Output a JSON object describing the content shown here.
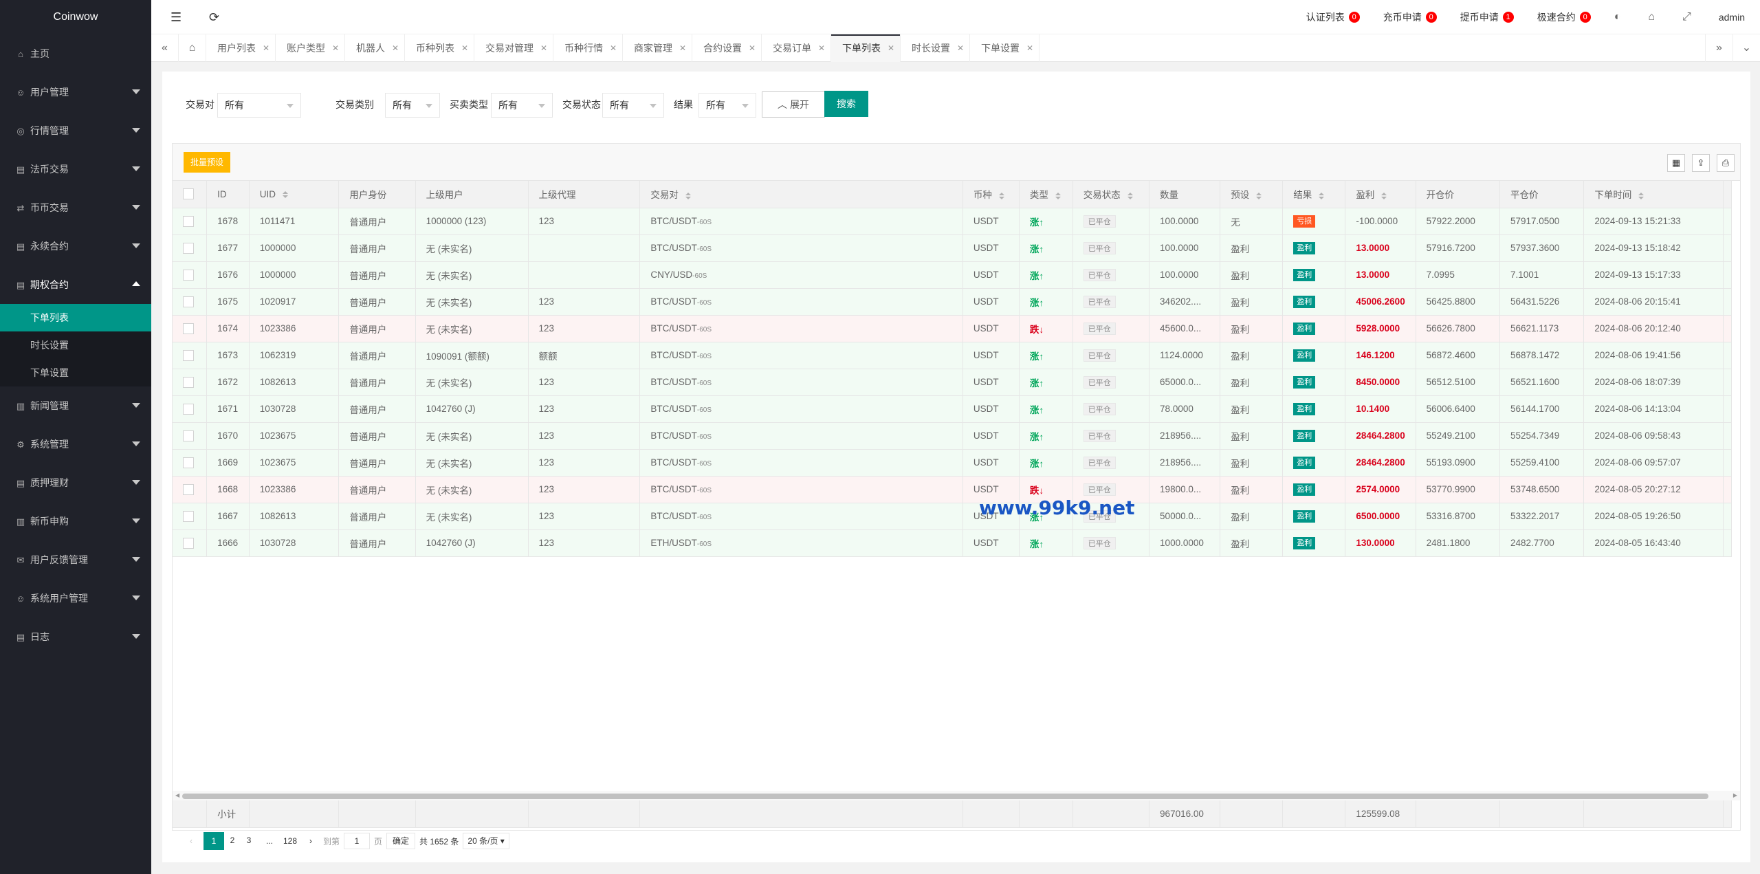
{
  "brand": "Coinwow",
  "sidebar": {
    "items": [
      {
        "label": "主页",
        "icon": "home-icon",
        "expand": false
      },
      {
        "label": "用户管理",
        "icon": "user-icon",
        "expand": true
      },
      {
        "label": "行情管理",
        "icon": "coin-icon",
        "expand": true
      },
      {
        "label": "法币交易",
        "icon": "doc-icon",
        "expand": true
      },
      {
        "label": "币币交易",
        "icon": "exchange-icon",
        "expand": true
      },
      {
        "label": "永续合约",
        "icon": "doc-icon",
        "expand": true
      },
      {
        "label": "期权合约",
        "icon": "doc-icon",
        "expand": true,
        "open": true
      }
    ],
    "submenu": [
      "下单列表",
      "时长设置",
      "下单设置"
    ],
    "items2": [
      {
        "label": "新闻管理",
        "icon": "news-icon"
      },
      {
        "label": "系统管理",
        "icon": "gear-icon"
      },
      {
        "label": "质押理财",
        "icon": "doc-icon"
      },
      {
        "label": "新币申购",
        "icon": "news-icon"
      },
      {
        "label": "用户反馈管理",
        "icon": "feedback-icon"
      },
      {
        "label": "系统用户管理",
        "icon": "user-icon"
      },
      {
        "label": "日志",
        "icon": "doc-icon"
      }
    ]
  },
  "header": {
    "links": [
      {
        "label": "认证列表",
        "count": "0"
      },
      {
        "label": "充币申请",
        "count": "0"
      },
      {
        "label": "提币申请",
        "count": "1"
      },
      {
        "label": "极速合约",
        "count": "0"
      }
    ],
    "user": "admin"
  },
  "tabs": [
    "用户列表",
    "账户类型",
    "机器人",
    "币种列表",
    "交易对管理",
    "币种行情",
    "商家管理",
    "合约设置",
    "交易订单",
    "下单列表",
    "时长设置",
    "下单设置"
  ],
  "active_tab": 9,
  "filters": {
    "pair_label": "交易对",
    "pair_value": "所有",
    "category_label": "交易类别",
    "category_value": "所有",
    "side_label": "买卖类型",
    "side_value": "所有",
    "status_label": "交易状态",
    "status_value": "所有",
    "result_label": "结果",
    "result_value": "所有",
    "expand_label": "展开",
    "search_label": "搜索"
  },
  "toolbar": {
    "batch_label": "批量预设"
  },
  "columns": [
    "ID",
    "UID",
    "用户身份",
    "上级用户",
    "上级代理",
    "交易对",
    "币种",
    "类型",
    "交易状态",
    "数量",
    "预设",
    "结果",
    "盈利",
    "开仓价",
    "平仓价",
    "下单时间"
  ],
  "rows": [
    {
      "id": "1678",
      "uid": "1011471",
      "role": "普通用户",
      "parent": "1000000 (123)",
      "agent": "123",
      "pair": "BTC/USDT",
      "pair_suffix": "-60S",
      "coin": "USDT",
      "type": "涨↑",
      "dir": "up",
      "status": "已平仓",
      "qty": "100.0000",
      "preset": "无",
      "result": "亏损",
      "res_type": "lose",
      "profit": "-100.0000",
      "open": "57922.2000",
      "close": "57917.0500",
      "time": "2024-09-13 15:21:33"
    },
    {
      "id": "1677",
      "uid": "1000000",
      "role": "普通用户",
      "parent": "无 (未实名)",
      "agent": "",
      "pair": "BTC/USDT",
      "pair_suffix": "-60S",
      "coin": "USDT",
      "type": "涨↑",
      "dir": "up",
      "status": "已平仓",
      "qty": "100.0000",
      "preset": "盈利",
      "result": "盈利",
      "res_type": "win",
      "profit": "13.0000",
      "open": "57916.7200",
      "close": "57937.3600",
      "time": "2024-09-13 15:18:42"
    },
    {
      "id": "1676",
      "uid": "1000000",
      "role": "普通用户",
      "parent": "无 (未实名)",
      "agent": "",
      "pair": "CNY/USD",
      "pair_suffix": "-60S",
      "coin": "USDT",
      "type": "涨↑",
      "dir": "up",
      "status": "已平仓",
      "qty": "100.0000",
      "preset": "盈利",
      "result": "盈利",
      "res_type": "win",
      "profit": "13.0000",
      "open": "7.0995",
      "close": "7.1001",
      "time": "2024-09-13 15:17:33"
    },
    {
      "id": "1675",
      "uid": "1020917",
      "role": "普通用户",
      "parent": "无 (未实名)",
      "agent": "123",
      "pair": "BTC/USDT",
      "pair_suffix": "-60S",
      "coin": "USDT",
      "type": "涨↑",
      "dir": "up",
      "status": "已平仓",
      "qty": "346202....",
      "preset": "盈利",
      "result": "盈利",
      "res_type": "win",
      "profit": "45006.2600",
      "open": "56425.8800",
      "close": "56431.5226",
      "time": "2024-08-06 20:15:41"
    },
    {
      "id": "1674",
      "uid": "1023386",
      "role": "普通用户",
      "parent": "无 (未实名)",
      "agent": "123",
      "pair": "BTC/USDT",
      "pair_suffix": "-60S",
      "coin": "USDT",
      "type": "跌↓",
      "dir": "down",
      "status": "已平仓",
      "qty": "45600.0...",
      "preset": "盈利",
      "result": "盈利",
      "res_type": "win",
      "profit": "5928.0000",
      "open": "56626.7800",
      "close": "56621.1173",
      "time": "2024-08-06 20:12:40"
    },
    {
      "id": "1673",
      "uid": "1062319",
      "role": "普通用户",
      "parent": "1090091 (额额)",
      "agent": "额额",
      "pair": "BTC/USDT",
      "pair_suffix": "-60S",
      "coin": "USDT",
      "type": "涨↑",
      "dir": "up",
      "status": "已平仓",
      "qty": "1124.0000",
      "preset": "盈利",
      "result": "盈利",
      "res_type": "win",
      "profit": "146.1200",
      "open": "56872.4600",
      "close": "56878.1472",
      "time": "2024-08-06 19:41:56"
    },
    {
      "id": "1672",
      "uid": "1082613",
      "role": "普通用户",
      "parent": "无 (未实名)",
      "agent": "123",
      "pair": "BTC/USDT",
      "pair_suffix": "-60S",
      "coin": "USDT",
      "type": "涨↑",
      "dir": "up",
      "status": "已平仓",
      "qty": "65000.0...",
      "preset": "盈利",
      "result": "盈利",
      "res_type": "win",
      "profit": "8450.0000",
      "open": "56512.5100",
      "close": "56521.1600",
      "time": "2024-08-06 18:07:39"
    },
    {
      "id": "1671",
      "uid": "1030728",
      "role": "普通用户",
      "parent": "1042760 (J)",
      "agent": "123",
      "pair": "BTC/USDT",
      "pair_suffix": "-60S",
      "coin": "USDT",
      "type": "涨↑",
      "dir": "up",
      "status": "已平仓",
      "qty": "78.0000",
      "preset": "盈利",
      "result": "盈利",
      "res_type": "win",
      "profit": "10.1400",
      "open": "56006.6400",
      "close": "56144.1700",
      "time": "2024-08-06 14:13:04"
    },
    {
      "id": "1670",
      "uid": "1023675",
      "role": "普通用户",
      "parent": "无 (未实名)",
      "agent": "123",
      "pair": "BTC/USDT",
      "pair_suffix": "-60S",
      "coin": "USDT",
      "type": "涨↑",
      "dir": "up",
      "status": "已平仓",
      "qty": "218956....",
      "preset": "盈利",
      "result": "盈利",
      "res_type": "win",
      "profit": "28464.2800",
      "open": "55249.2100",
      "close": "55254.7349",
      "time": "2024-08-06 09:58:43"
    },
    {
      "id": "1669",
      "uid": "1023675",
      "role": "普通用户",
      "parent": "无 (未实名)",
      "agent": "123",
      "pair": "BTC/USDT",
      "pair_suffix": "-60S",
      "coin": "USDT",
      "type": "涨↑",
      "dir": "up",
      "status": "已平仓",
      "qty": "218956....",
      "preset": "盈利",
      "result": "盈利",
      "res_type": "win",
      "profit": "28464.2800",
      "open": "55193.0900",
      "close": "55259.4100",
      "time": "2024-08-06 09:57:07"
    },
    {
      "id": "1668",
      "uid": "1023386",
      "role": "普通用户",
      "parent": "无 (未实名)",
      "agent": "123",
      "pair": "BTC/USDT",
      "pair_suffix": "-60S",
      "coin": "USDT",
      "type": "跌↓",
      "dir": "down",
      "status": "已平仓",
      "qty": "19800.0...",
      "preset": "盈利",
      "result": "盈利",
      "res_type": "win",
      "profit": "2574.0000",
      "open": "53770.9900",
      "close": "53748.6500",
      "time": "2024-08-05 20:27:12"
    },
    {
      "id": "1667",
      "uid": "1082613",
      "role": "普通用户",
      "parent": "无 (未实名)",
      "agent": "123",
      "pair": "BTC/USDT",
      "pair_suffix": "-60S",
      "coin": "USDT",
      "type": "涨↑",
      "dir": "up",
      "status": "已平仓",
      "qty": "50000.0...",
      "preset": "盈利",
      "result": "盈利",
      "res_type": "win",
      "profit": "6500.0000",
      "open": "53316.8700",
      "close": "53322.2017",
      "time": "2024-08-05 19:26:50"
    },
    {
      "id": "1666",
      "uid": "1030728",
      "role": "普通用户",
      "parent": "1042760 (J)",
      "agent": "123",
      "pair": "ETH/USDT",
      "pair_suffix": "-60S",
      "coin": "USDT",
      "type": "涨↑",
      "dir": "up",
      "status": "已平仓",
      "qty": "1000.0000",
      "preset": "盈利",
      "result": "盈利",
      "res_type": "win",
      "profit": "130.0000",
      "open": "2481.1800",
      "close": "2482.7700",
      "time": "2024-08-05 16:43:40"
    }
  ],
  "totals": {
    "label": "小计",
    "qty": "967016.00",
    "profit": "125599.08"
  },
  "pager": {
    "pages": [
      "1",
      "2",
      "3"
    ],
    "ellipsis": "...",
    "last": "128",
    "goto_label": "到第",
    "goto_value": "1",
    "page_unit": "页",
    "confirm_label": "确定",
    "total_text": "共 1652 条",
    "page_size": "20 条/页"
  },
  "watermark": "www.99k9.net",
  "colors": {
    "accent": "#009688",
    "sidebar_bg": "#20222a",
    "warn": "#ffb800",
    "up": "#00a65a",
    "down": "#d9001b",
    "lose": "#ff5722"
  }
}
